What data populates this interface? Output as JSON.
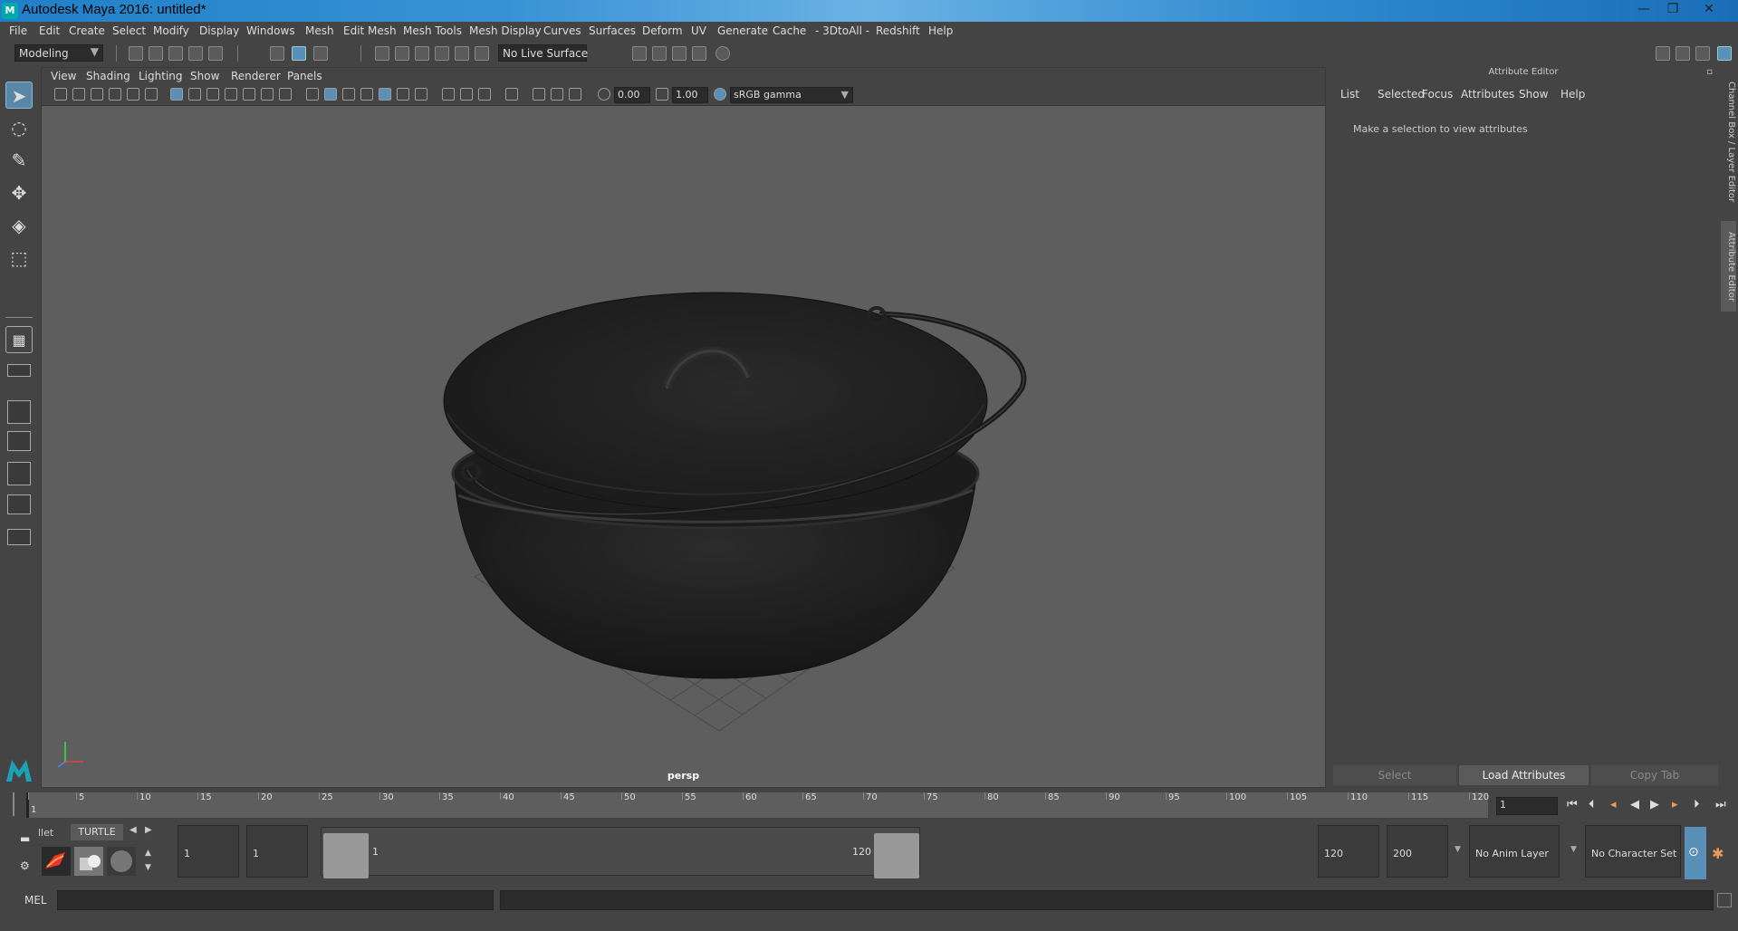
{
  "window": {
    "title": "Autodesk Maya 2016: untitled*",
    "controls": [
      "—",
      "❐",
      "✕"
    ]
  },
  "menubar": {
    "items": [
      "File",
      "Edit",
      "Create",
      "Select",
      "Modify",
      "Display",
      "Windows",
      "Mesh",
      "Edit Mesh",
      "Mesh Tools",
      "Mesh Display",
      "Curves",
      "Surfaces",
      "Deform",
      "UV",
      "Generate",
      "Cache",
      "- 3DtoAll -",
      "Redshift",
      "Help"
    ]
  },
  "shelf": {
    "mode": "Modeling",
    "live_surface": "No Live Surface"
  },
  "viewport": {
    "menu": [
      "View",
      "Shading",
      "Lighting",
      "Show",
      "Renderer",
      "Panels"
    ],
    "exposure": "0.00",
    "gamma": "1.00",
    "color_space": "sRGB gamma",
    "camera_label": "persp"
  },
  "attribute_editor": {
    "header": "Attribute Editor",
    "menu": [
      "List",
      "Selected",
      "Focus",
      "Attributes",
      "Show",
      "Help"
    ],
    "message": "Make a selection to view attributes",
    "buttons": {
      "select": "Select",
      "load": "Load Attributes",
      "copy": "Copy Tab"
    },
    "side_tabs": [
      "Channel Box / Layer Editor",
      "Attribute Editor"
    ]
  },
  "timeline": {
    "ticks": [
      "1",
      "5",
      "10",
      "15",
      "20",
      "25",
      "30",
      "35",
      "40",
      "45",
      "50",
      "55",
      "60",
      "65",
      "70",
      "75",
      "80",
      "85",
      "90",
      "95",
      "100",
      "105",
      "110",
      "115",
      "120"
    ],
    "current_frame": "1"
  },
  "range": {
    "shelf_tab_partial": "llet",
    "shelf_tab": "TURTLE",
    "start": "1",
    "playback_start": "1",
    "slider_min": "1",
    "slider_max": "120",
    "playback_end": "120",
    "end": "200",
    "anim_layer": "No Anim Layer",
    "character_set": "No Character Set"
  },
  "command": {
    "label": "MEL"
  },
  "colors": {
    "accent": "#5a8fb8",
    "viewport_bg": "#5e5e5e",
    "panel_bg": "#444444",
    "title_blue": "#2f8ad0"
  }
}
